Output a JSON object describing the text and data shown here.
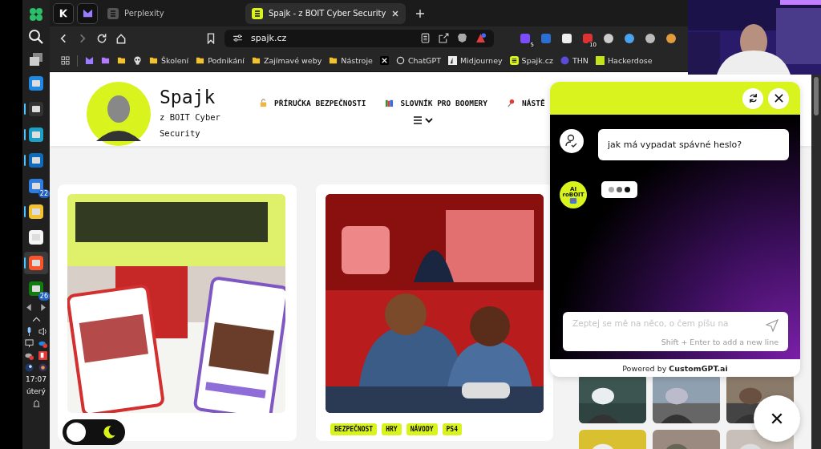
{
  "taskbar": {
    "apps": [
      {
        "running": false,
        "selected": false
      },
      {
        "running": true,
        "selected": false
      },
      {
        "running": true,
        "selected": false
      },
      {
        "running": true,
        "selected": false
      },
      {
        "running": false,
        "selected": false,
        "badge": "22"
      },
      {
        "running": true,
        "selected": false
      },
      {
        "running": false,
        "selected": false
      },
      {
        "running": true,
        "selected": true
      },
      {
        "running": false,
        "selected": false,
        "badge": "26"
      }
    ],
    "clock": {
      "time": "17:07",
      "day": "úterý"
    }
  },
  "tabs": [
    {
      "label": "Perplexity",
      "selected": false
    },
    {
      "label": "Spajk - z BOIT Cyber Security",
      "selected": true
    }
  ],
  "address_bar": {
    "url": "spajk.cz"
  },
  "extensions": [
    {
      "badge": "5"
    },
    {
      "badge": "10"
    }
  ],
  "bookmarks": [
    {
      "kind": "folder",
      "label": "Školení"
    },
    {
      "kind": "folder",
      "label": "Podnikání"
    },
    {
      "kind": "folder",
      "label": "Zajímavé weby"
    },
    {
      "kind": "folder",
      "label": "Nástroje"
    },
    {
      "kind": "x"
    },
    {
      "kind": "chatgpt",
      "label": "ChatGPT"
    },
    {
      "kind": "midjourney",
      "label": "Midjourney"
    },
    {
      "kind": "spajk",
      "label": "Spajk.cz"
    },
    {
      "kind": "thn",
      "label": "THN"
    },
    {
      "kind": "hackerdose",
      "label": "Hackerdose"
    }
  ],
  "site": {
    "title": "Spajk",
    "subtitle": "z BOIT Cyber Security",
    "nav": [
      {
        "kind": "lock",
        "label": "PŘÍRUČKA BEZPEČNOSTI"
      },
      {
        "kind": "books",
        "label": "SLOVNÍK PRO BOOMERY"
      },
      {
        "kind": "pin",
        "label": "NÁSTĚ"
      }
    ]
  },
  "posts": [
    {
      "kind": "picture"
    },
    {
      "kind": "picture",
      "tags": [
        "BEZPEČNOST",
        "HRY",
        "NÁVODY",
        "PS4"
      ]
    }
  ],
  "chat": {
    "messages": [
      {
        "kind": "user",
        "text": "jak má vypadat spávné heslo?",
        "typing": false
      },
      {
        "kind": "bot",
        "typing": true
      }
    ],
    "bot_avatar": "AI roBOIT",
    "input": {
      "placeholder": "Zeptej se mě na něco, o čem píšu na",
      "hint": "Shift + Enter to add a new line"
    },
    "powered_by": "Powered by **CustomGPT.ai**"
  },
  "theme_options": [
    {
      "kind": "light",
      "selected": false
    },
    {
      "kind": "dark",
      "selected": true
    }
  ]
}
